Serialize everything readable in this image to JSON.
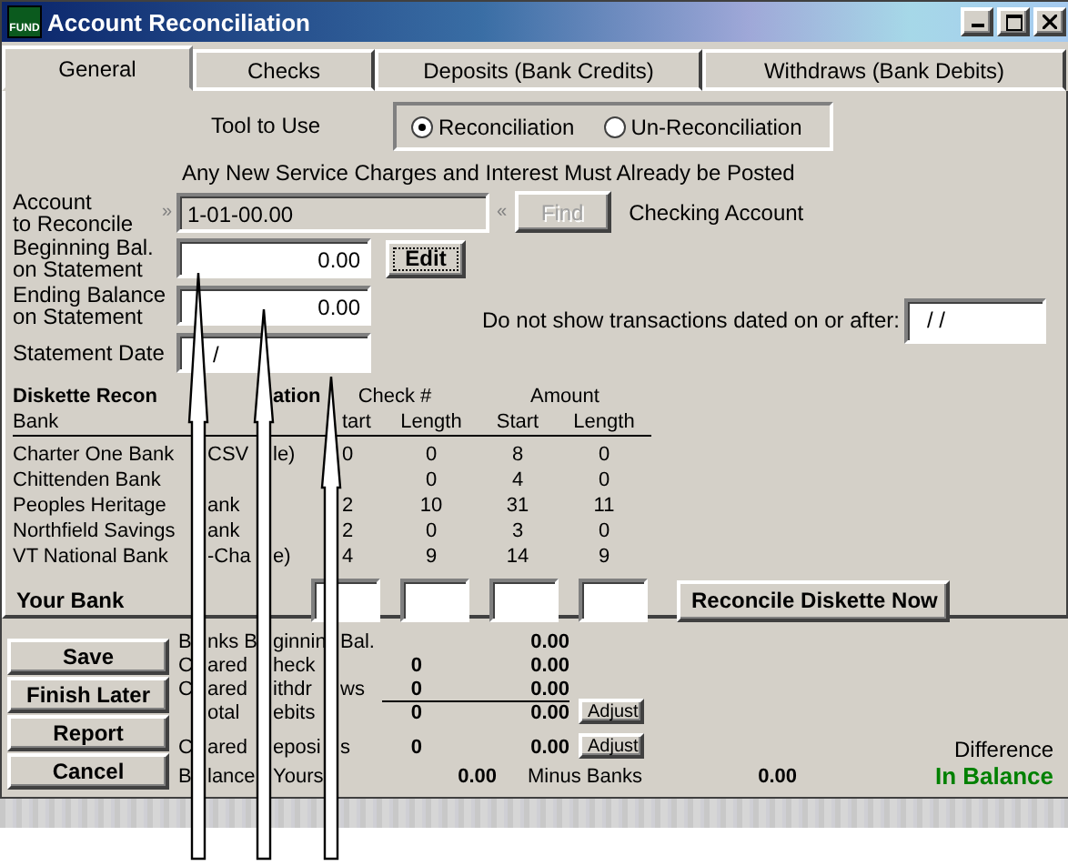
{
  "window": {
    "title": "Account Reconciliation",
    "icon_text": "FUND"
  },
  "tabs": [
    {
      "label": "General",
      "selected": true
    },
    {
      "label": "Checks",
      "selected": false
    },
    {
      "label": "Deposits (Bank Credits)",
      "selected": false
    },
    {
      "label": "Withdraws (Bank Debits)",
      "selected": false
    }
  ],
  "tool": {
    "label": "Tool to Use",
    "options": [
      {
        "label": "Reconciliation",
        "selected": true
      },
      {
        "label": "Un-Reconciliation",
        "selected": false
      }
    ]
  },
  "notice": "Any New Service Charges and Interest Must Already be Posted",
  "account": {
    "label_lines": [
      "Account",
      "to Reconcile"
    ],
    "open_mark": "»",
    "value": "1-01-00.00",
    "close_mark": "«",
    "find_button": {
      "label": "Find",
      "disabled": true
    },
    "description": "Checking Account"
  },
  "beginning_balance": {
    "label_lines": [
      "Beginning Bal.",
      "on Statement"
    ],
    "value": "0.00",
    "edit_button": "Edit"
  },
  "ending_balance": {
    "label_lines": [
      "Ending Balance",
      "on Statement"
    ],
    "value": "0.00"
  },
  "statement_date": {
    "label_lines": [
      "Statement Date"
    ],
    "value": "/"
  },
  "cutoff": {
    "label": "Do not show transactions dated on or after:",
    "value": "/ /"
  },
  "diskette": {
    "title_parts": [
      "Diskette Recon",
      "ation"
    ],
    "group_headers": [
      "Check #",
      "Amount"
    ],
    "bank_header": "Bank",
    "columns": [
      "tart",
      "Length",
      "Start",
      "Length"
    ],
    "rows": [
      {
        "bank_parts": [
          "Charter One Bank",
          "CSV",
          "le)"
        ],
        "cells": [
          "0",
          "0",
          "8",
          "0"
        ]
      },
      {
        "bank_parts": [
          "Chittenden Bank"
        ],
        "cells": [
          null,
          "0",
          "4",
          "0"
        ]
      },
      {
        "bank_parts": [
          "Peoples Heritage",
          "ank"
        ],
        "cells": [
          "2",
          "10",
          "31",
          "11"
        ]
      },
      {
        "bank_parts": [
          "Northfield Savings",
          "ank"
        ],
        "cells": [
          "2",
          "0",
          "3",
          "0"
        ]
      },
      {
        "bank_parts": [
          "VT National Bank",
          "-Cha",
          "e)"
        ],
        "cells": [
          "4",
          "9",
          "14",
          "9"
        ]
      }
    ],
    "your_bank_label": "Your Bank",
    "button": "Reconcile Diskette Now"
  },
  "buttons": [
    "Save",
    "Finish Later",
    "Report",
    "Cancel"
  ],
  "summary": {
    "rows": [
      {
        "kind": "line",
        "label_parts": [
          "B",
          "nks B",
          "ginnin",
          "Bal."
        ],
        "amount": "0.00"
      },
      {
        "kind": "line",
        "label_parts": [
          "C",
          "ared",
          "heck"
        ],
        "count": "0",
        "amount": "0.00"
      },
      {
        "kind": "line",
        "label_parts": [
          "C",
          "ared",
          "ithdr",
          "ws"
        ],
        "count": "0",
        "amount": "0.00"
      },
      {
        "kind": "total",
        "label_parts": [
          "otal",
          "ebits"
        ],
        "count": "0",
        "amount": "0.00",
        "adjust": "Adjust"
      },
      {
        "kind": "line",
        "label_parts": [
          "C",
          "ared",
          "eposi",
          "s"
        ],
        "count": "0",
        "amount": "0.00",
        "adjust": "Adjust"
      }
    ],
    "balance": {
      "label_parts": [
        "B",
        "lance",
        "Yours"
      ],
      "yours": "0.00",
      "minus_label": "Minus Banks",
      "banks": "0.00"
    },
    "difference": {
      "label": "Difference",
      "status": "In Balance"
    }
  }
}
